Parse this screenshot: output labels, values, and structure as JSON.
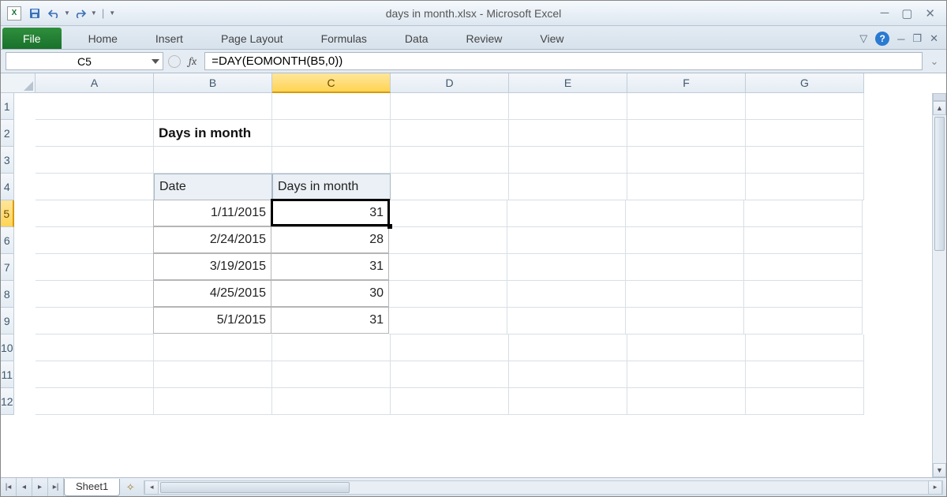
{
  "title": "days in month.xlsx - Microsoft Excel",
  "ribbon": {
    "file": "File",
    "tabs": [
      "Home",
      "Insert",
      "Page Layout",
      "Formulas",
      "Data",
      "Review",
      "View"
    ]
  },
  "name_box": "C5",
  "formula": "=DAY(EOMONTH(B5,0))",
  "columns": [
    "A",
    "B",
    "C",
    "D",
    "E",
    "F",
    "G"
  ],
  "selected_col": "C",
  "row_count": 12,
  "selected_row": 5,
  "content": {
    "title": "Days in month",
    "hdr_date": "Date",
    "hdr_days": "Days in month",
    "rows": [
      {
        "date": "1/11/2015",
        "days": "31"
      },
      {
        "date": "2/24/2015",
        "days": "28"
      },
      {
        "date": "3/19/2015",
        "days": "31"
      },
      {
        "date": "4/25/2015",
        "days": "30"
      },
      {
        "date": "5/1/2015",
        "days": "31"
      }
    ]
  },
  "sheet_tab": "Sheet1"
}
